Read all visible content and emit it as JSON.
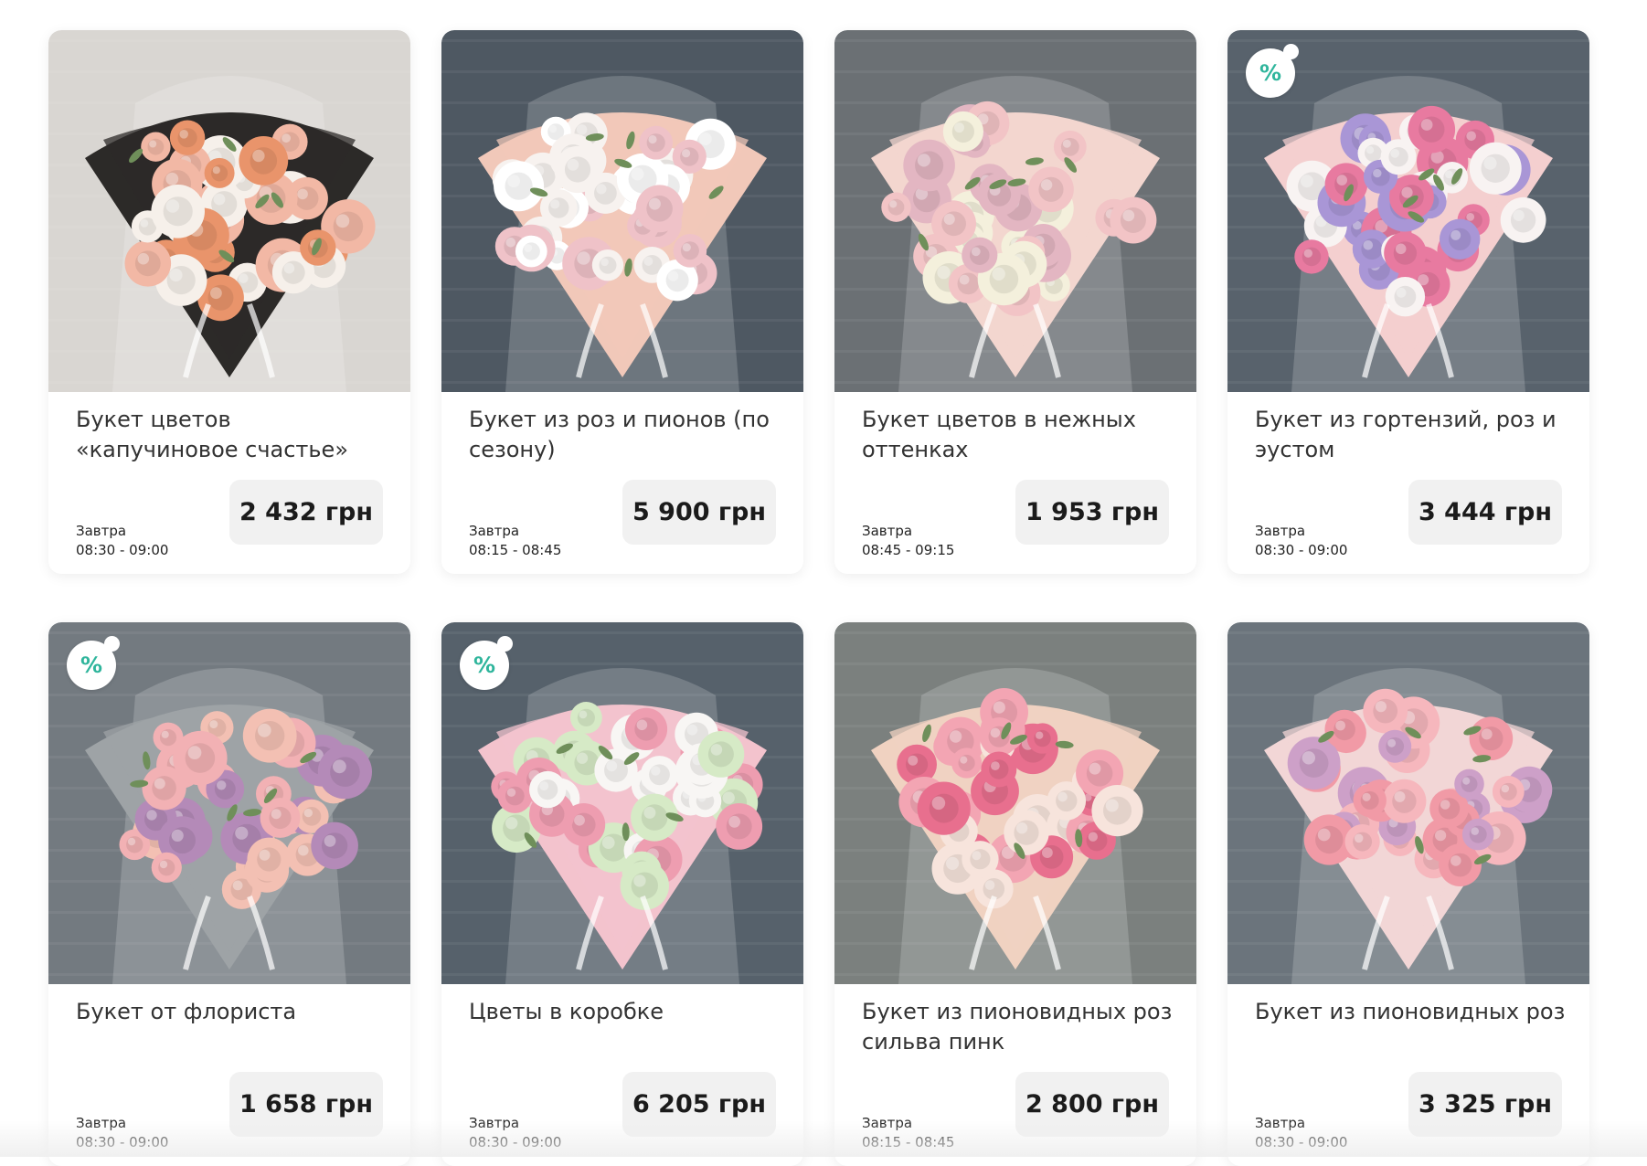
{
  "products": [
    {
      "name": "Букет цветов «капучиновое счастье»",
      "delivery_day": "Завтра",
      "delivery_time": "08:30 - 09:00",
      "price": "2 432 грн",
      "discount": false,
      "discount_label": "",
      "palette": {
        "bg": "#d9d6d2",
        "wrap": "#2c2a28",
        "f1": "#e9946b",
        "f2": "#f2b8a5",
        "f3": "#f6f0ea"
      }
    },
    {
      "name": "Букет из роз и пионов (по сезону)",
      "delivery_day": "Завтра",
      "delivery_time": "08:15 - 08:45",
      "price": "5 900 грн",
      "discount": false,
      "discount_label": "",
      "palette": {
        "bg": "#4e5862",
        "wrap": "#f1c8b9",
        "f1": "#f7f2ef",
        "f2": "#efc2c8",
        "f3": "#ffffff"
      }
    },
    {
      "name": "Букет цветов в нежных оттенках",
      "delivery_day": "Завтра",
      "delivery_time": "08:45 - 09:15",
      "price": "1 953 грн",
      "discount": false,
      "discount_label": "",
      "palette": {
        "bg": "#6b7074",
        "wrap": "#f3d6cf",
        "f1": "#f2c4c6",
        "f2": "#f4f0dc",
        "f3": "#e3b6c2"
      }
    },
    {
      "name": "Букет из гортензий, роз и эустом",
      "delivery_day": "Завтра",
      "delivery_time": "08:30 - 09:00",
      "price": "3 444 грн",
      "discount": true,
      "discount_label": "%",
      "palette": {
        "bg": "#58626c",
        "wrap": "#f4cfcf",
        "f1": "#e87aa0",
        "f2": "#a996d6",
        "f3": "#f8f3f2"
      }
    },
    {
      "name": "Букет от флориста",
      "delivery_day": "Завтра",
      "delivery_time": "08:30 - 09:00",
      "price": "1 658 грн",
      "discount": true,
      "discount_label": "%",
      "palette": {
        "bg": "#737a80",
        "wrap": "#9ea3a6",
        "f1": "#f2b1b4",
        "f2": "#b48ab8",
        "f3": "#f3c0b3"
      }
    },
    {
      "name": "Цветы в коробке",
      "delivery_day": "Завтра",
      "delivery_time": "08:30 - 09:00",
      "price": "6 205 грн",
      "discount": true,
      "discount_label": "%",
      "palette": {
        "bg": "#56616b",
        "wrap": "#f3c3cd",
        "f1": "#f8f6f4",
        "f2": "#ee9db0",
        "f3": "#d6eac6"
      }
    },
    {
      "name": "Букет из пионовидных роз сильва пинк",
      "delivery_day": "Завтра",
      "delivery_time": "08:15 - 08:45",
      "price": "2 800 грн",
      "discount": false,
      "discount_label": "",
      "palette": {
        "bg": "#7b807e",
        "wrap": "#f0d2c1",
        "f1": "#e86f8e",
        "f2": "#f3a5b3",
        "f3": "#f7e4dc"
      }
    },
    {
      "name": "Букет из пионовидных роз",
      "delivery_day": "Завтра",
      "delivery_time": "08:30 - 09:00",
      "price": "3 325 грн",
      "discount": false,
      "discount_label": "",
      "palette": {
        "bg": "#6b747c",
        "wrap": "#f2d6d6",
        "f1": "#f19aa6",
        "f2": "#f6b7bd",
        "f3": "#cda0c8"
      }
    }
  ]
}
